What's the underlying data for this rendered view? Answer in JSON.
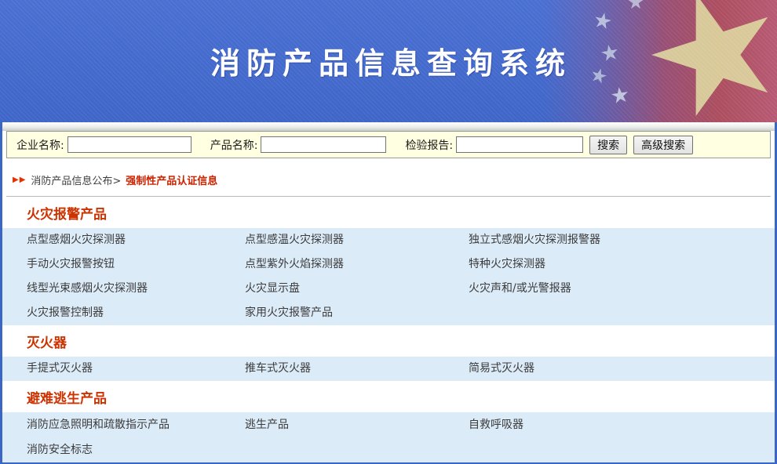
{
  "banner": {
    "title": "消防产品信息查询系统"
  },
  "search": {
    "fields": [
      {
        "label": "企业名称:",
        "value": ""
      },
      {
        "label": "产品名称:",
        "value": ""
      },
      {
        "label": "检验报告:",
        "value": ""
      }
    ],
    "search_button": "搜索",
    "advanced_button": "高级搜索"
  },
  "breadcrumb": {
    "arrows": "▶▶",
    "root": "消防产品信息公布>",
    "current": "强制性产品认证信息"
  },
  "sections": [
    {
      "title": "火灾报警产品",
      "items": [
        "点型感烟火灾探测器",
        "点型感温火灾探测器",
        "独立式感烟火灾探测报警器",
        "手动火灾报警按钮",
        "点型紫外火焰探测器",
        "特种火灾探测器",
        "线型光束感烟火灾探测器",
        "火灾显示盘",
        "火灾声和/或光警报器",
        "火灾报警控制器",
        "家用火灾报警产品"
      ]
    },
    {
      "title": "灭火器",
      "items": [
        "手提式灭火器",
        "推车式灭火器",
        "简易式灭火器"
      ]
    },
    {
      "title": "避难逃生产品",
      "items": [
        "消防应急照明和疏散指示产品",
        "逃生产品",
        "自救呼吸器",
        "消防安全标志"
      ]
    }
  ],
  "colors": {
    "banner_blue": "#4368CE",
    "accent_red": "#CC3300",
    "search_bar_bg": "#FFFFE1",
    "row_block_blue": "#DCEBF8",
    "border_blue": "#3A67C6",
    "item_text": "#3B3B3B"
  }
}
